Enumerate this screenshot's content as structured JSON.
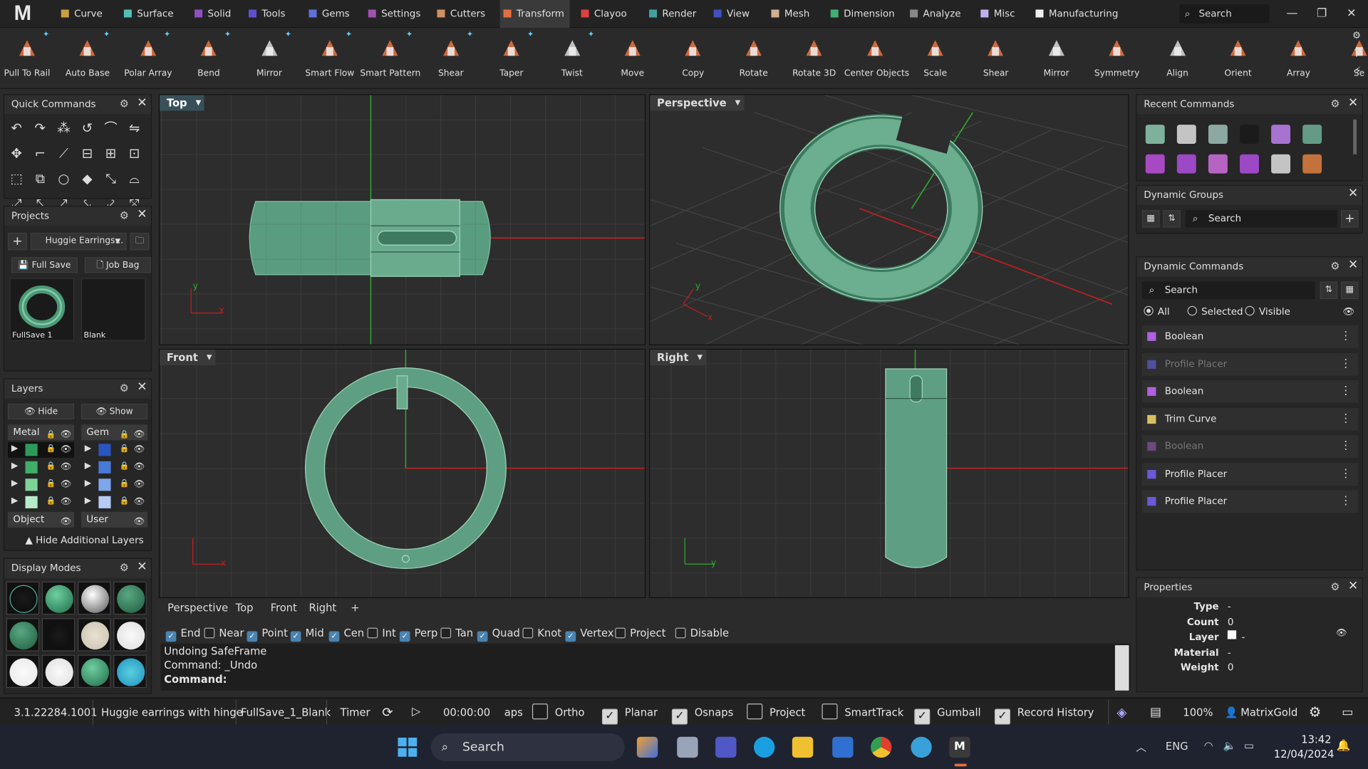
{
  "menu": {
    "tabs": [
      {
        "label": "Curve",
        "color": "#c8a040"
      },
      {
        "label": "Surface",
        "color": "#50c0b0"
      },
      {
        "label": "Solid",
        "color": "#9050c0"
      },
      {
        "label": "Tools",
        "color": "#6050d0"
      },
      {
        "label": "Gems",
        "color": "#6070d8"
      },
      {
        "label": "Settings",
        "color": "#a050b0"
      },
      {
        "label": "Cutters",
        "color": "#d09060"
      },
      {
        "label": "Transform",
        "color": "#e07040"
      },
      {
        "label": "Clayoo",
        "color": "#e04040"
      },
      {
        "label": "Render",
        "color": "#40a0a0"
      },
      {
        "label": "View",
        "color": "#4050c0"
      },
      {
        "label": "Mesh",
        "color": "#d0b090"
      },
      {
        "label": "Dimension",
        "color": "#40b070"
      },
      {
        "label": "Analyze",
        "color": "#888888"
      },
      {
        "label": "Misc",
        "color": "#c0b0f0"
      },
      {
        "label": "Manufacturing",
        "color": "#f0f0f0"
      }
    ],
    "active_tab": "Transform",
    "search_placeholder": "Search"
  },
  "toolbar": {
    "tools": [
      {
        "label": "Pull To Rail",
        "icon": "pull-to-rail-icon"
      },
      {
        "label": "Auto Base",
        "icon": "auto-base-icon"
      },
      {
        "label": "Polar Array",
        "icon": "polar-array-icon"
      },
      {
        "label": "Bend",
        "icon": "bend-icon"
      },
      {
        "label": "Mirror",
        "icon": "mirror-icon"
      },
      {
        "label": "Smart Flow",
        "icon": "smart-flow-icon"
      },
      {
        "label": "Smart Pattern",
        "icon": "smart-pattern-icon"
      },
      {
        "label": "Shear",
        "icon": "shear-icon"
      },
      {
        "label": "Taper",
        "icon": "taper-icon"
      },
      {
        "label": "Twist",
        "icon": "twist-icon"
      },
      {
        "label": "Move",
        "icon": "move-icon"
      },
      {
        "label": "Copy",
        "icon": "copy-icon"
      },
      {
        "label": "Rotate",
        "icon": "rotate-icon"
      },
      {
        "label": "Rotate 3D",
        "icon": "rotate-3d-icon"
      },
      {
        "label": "Center Objects",
        "icon": "center-objects-icon"
      },
      {
        "label": "Scale",
        "icon": "scale-icon"
      },
      {
        "label": "Shear",
        "icon": "shear-icon"
      },
      {
        "label": "Mirror",
        "icon": "mirror-icon"
      },
      {
        "label": "Symmetry",
        "icon": "symmetry-icon"
      },
      {
        "label": "Align",
        "icon": "align-icon"
      },
      {
        "label": "Orient",
        "icon": "orient-icon"
      },
      {
        "label": "Array",
        "icon": "array-icon"
      },
      {
        "label": "Se",
        "icon": "set-icon"
      }
    ]
  },
  "quick_commands": {
    "title": "Quick Commands"
  },
  "projects": {
    "title": "Projects",
    "selected": "Huggie Earrings...",
    "full_save": "Full Save",
    "job_bag": "Job Bag",
    "thumbs": [
      {
        "label": "FullSave 1"
      },
      {
        "label": "Blank"
      }
    ]
  },
  "layers": {
    "title": "Layers",
    "hide": "Hide",
    "show": "Show",
    "groups": [
      "Metal",
      "Gem"
    ],
    "extra": [
      "Object",
      "User"
    ],
    "metal_colors": [
      "#2e9a5a",
      "#3fae6a",
      "#7fd39a",
      "#b7ebc7"
    ],
    "gem_colors": [
      "#2a55c0",
      "#4a7ad8",
      "#7ea6ec",
      "#b5caf4"
    ],
    "footer": "Hide Additional Layers"
  },
  "display_modes": {
    "title": "Display Modes"
  },
  "viewports": {
    "top": "Top",
    "perspective": "Perspective",
    "front": "Front",
    "right": "Right"
  },
  "view_tabs": [
    "Perspective",
    "Top",
    "Front",
    "Right",
    "+"
  ],
  "osnaps": [
    {
      "label": "End",
      "on": true
    },
    {
      "label": "Near",
      "on": false
    },
    {
      "label": "Point",
      "on": true
    },
    {
      "label": "Mid",
      "on": true
    },
    {
      "label": "Cen",
      "on": true
    },
    {
      "label": "Int",
      "on": false
    },
    {
      "label": "Perp",
      "on": true
    },
    {
      "label": "Tan",
      "on": false
    },
    {
      "label": "Quad",
      "on": true
    },
    {
      "label": "Knot",
      "on": false
    },
    {
      "label": "Vertex",
      "on": true
    },
    {
      "label": "Project",
      "on": false
    },
    {
      "label": "Disable",
      "on": false
    }
  ],
  "command": {
    "line1": "Undoing SafeFrame",
    "line2": "Command: _Undo",
    "prompt": "Command:"
  },
  "recent_commands": {
    "title": "Recent Commands"
  },
  "dynamic_groups": {
    "title": "Dynamic Groups",
    "search": "Search"
  },
  "dynamic_commands": {
    "title": "Dynamic Commands",
    "search": "Search",
    "filters": [
      {
        "label": "All",
        "on": true
      },
      {
        "label": "Selected",
        "on": false
      },
      {
        "label": "Visible",
        "on": false
      }
    ],
    "items": [
      {
        "label": "Boolean",
        "color": "#b060e0",
        "dim": false
      },
      {
        "label": "Profile Placer",
        "color": "#5050a0",
        "dim": true
      },
      {
        "label": "Boolean",
        "color": "#b060e0",
        "dim": false
      },
      {
        "label": "Trim Curve",
        "color": "#d8c060",
        "dim": false
      },
      {
        "label": "Boolean",
        "color": "#6a4a80",
        "dim": true
      },
      {
        "label": "Profile Placer",
        "color": "#6a5ad8",
        "dim": false
      },
      {
        "label": "Profile Placer",
        "color": "#6a5ad8",
        "dim": false
      }
    ]
  },
  "properties": {
    "title": "Properties",
    "rows": [
      {
        "key": "Type",
        "value": "-"
      },
      {
        "key": "Count",
        "value": "0"
      },
      {
        "key": "Layer",
        "value": "-"
      },
      {
        "key": "Material",
        "value": "-"
      },
      {
        "key": "Weight",
        "value": "0"
      }
    ]
  },
  "status": {
    "version": "3.1.22284.1001",
    "project": "Huggie earrings with hinge",
    "save": "FullSave_1_Blank",
    "timer": "Timer",
    "time": "00:00:00",
    "aps": "aps",
    "toggles": [
      {
        "label": "Ortho",
        "on": false
      },
      {
        "label": "Planar",
        "on": true
      },
      {
        "label": "Osnaps",
        "on": true
      },
      {
        "label": "Project",
        "on": false
      },
      {
        "label": "SmartTrack",
        "on": false
      },
      {
        "label": "Gumball",
        "on": true
      },
      {
        "label": "Record History",
        "on": true
      }
    ],
    "zoom": "100%",
    "user": "MatrixGold"
  },
  "taskbar": {
    "search": "Search",
    "lang": "ENG",
    "time": "13:42",
    "date": "12/04/2024"
  }
}
